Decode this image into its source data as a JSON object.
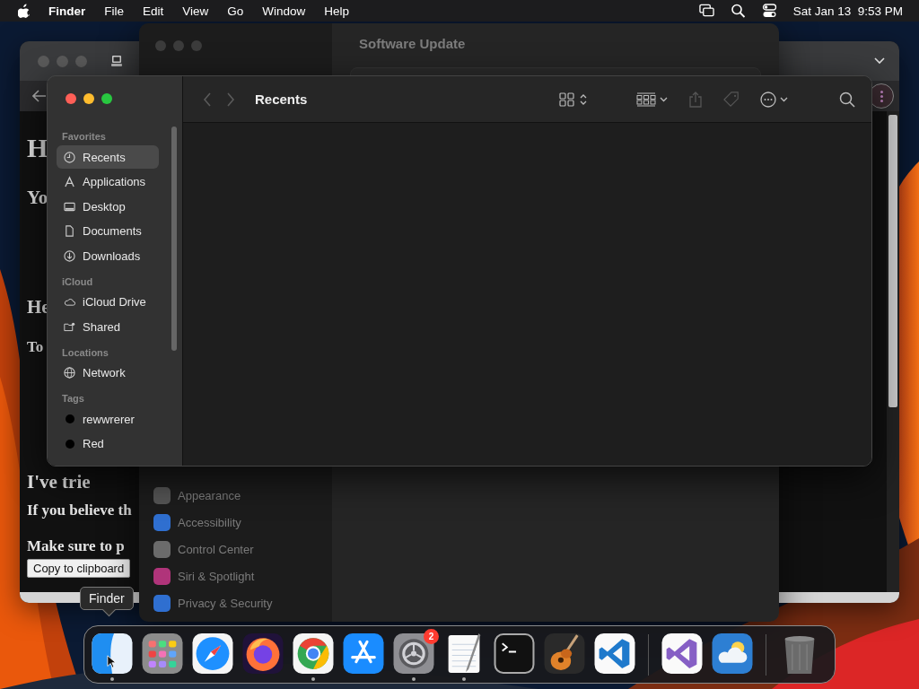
{
  "menu_bar": {
    "app": "Finder",
    "menus": [
      "File",
      "Edit",
      "View",
      "Go",
      "Window",
      "Help"
    ],
    "clock": "Sat Jan 13  9:53 PM"
  },
  "browser_window": {
    "page_lines": [
      {
        "kind": "h1",
        "text": "H"
      },
      {
        "kind": "h2",
        "text": "Yo"
      },
      {
        "kind": "h2",
        "text": "He"
      },
      {
        "kind": "p",
        "text": "To"
      },
      {
        "kind": "h2",
        "text": "I've trie"
      },
      {
        "kind": "p",
        "text": "If you believe th"
      },
      {
        "kind": "p",
        "text": "Make sure to p"
      }
    ],
    "copy_button": "Copy to clipboard"
  },
  "settings_window": {
    "title": "Software Update",
    "sidebar_items": [
      {
        "label": "Appearance",
        "color": "#555555"
      },
      {
        "label": "Accessibility",
        "color": "#2f6fd0"
      },
      {
        "label": "Control Center",
        "color": "#6b6b6b"
      },
      {
        "label": "Siri & Spotlight",
        "color": "#b0347a"
      },
      {
        "label": "Privacy & Security",
        "color": "#2f6fd0"
      }
    ]
  },
  "finder_window": {
    "title": "Recents",
    "sidebar": [
      {
        "heading": "Favorites",
        "items": [
          {
            "label": "Recents",
            "kind": "clock",
            "selected": true
          },
          {
            "label": "Applications",
            "kind": "apps",
            "selected": false
          },
          {
            "label": "Desktop",
            "kind": "desktop",
            "selected": false
          },
          {
            "label": "Documents",
            "kind": "document",
            "selected": false
          },
          {
            "label": "Downloads",
            "kind": "download",
            "selected": false
          }
        ]
      },
      {
        "heading": "iCloud",
        "items": [
          {
            "label": "iCloud Drive",
            "kind": "cloud",
            "selected": false
          },
          {
            "label": "Shared",
            "kind": "shared",
            "selected": false
          }
        ]
      },
      {
        "heading": "Locations",
        "items": [
          {
            "label": "Network",
            "kind": "network",
            "selected": false
          }
        ]
      },
      {
        "heading": "Tags",
        "items": [
          {
            "label": "rewwrerer",
            "kind": "tag",
            "color": "#000000",
            "selected": false
          },
          {
            "label": "Red",
            "kind": "tag",
            "color": "#000000",
            "selected": false
          }
        ]
      }
    ]
  },
  "tooltip": "Finder",
  "dock": {
    "apps": [
      {
        "kind": "finder",
        "running": true
      },
      {
        "kind": "launchpad",
        "running": false
      },
      {
        "kind": "safari",
        "running": false
      },
      {
        "kind": "firefox",
        "running": false
      },
      {
        "kind": "chrome",
        "running": true
      },
      {
        "kind": "appstore",
        "running": false
      },
      {
        "kind": "settings",
        "running": true,
        "badge": "2"
      },
      {
        "kind": "textedit",
        "running": true
      },
      {
        "kind": "terminal",
        "running": false
      },
      {
        "kind": "garageband",
        "running": false
      },
      {
        "kind": "vscode",
        "running": false
      },
      {
        "kind": "divider"
      },
      {
        "kind": "visualstudio",
        "running": false
      },
      {
        "kind": "weather",
        "running": false
      },
      {
        "kind": "divider"
      },
      {
        "kind": "trash",
        "running": false
      }
    ]
  }
}
